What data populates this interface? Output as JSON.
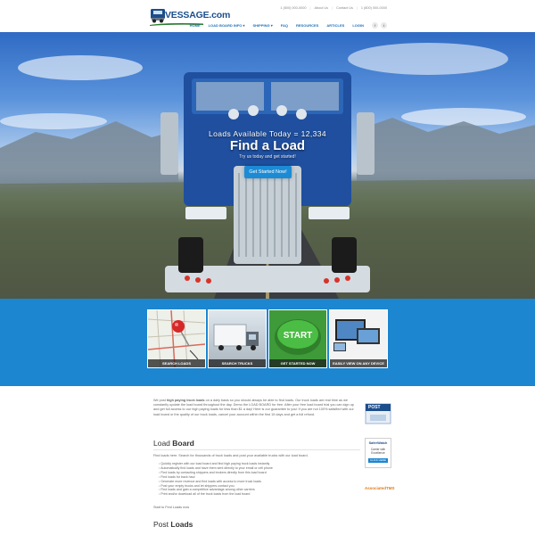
{
  "brand": {
    "name": "VESSAGE.com"
  },
  "utility": {
    "items": [
      "1 (800) 000-0000",
      "About Us",
      "Contact Us",
      "1 (800) 000-0000"
    ]
  },
  "nav": {
    "items": [
      "Home",
      "Load Board Info ▾",
      "Shipping ▾",
      "FAQ",
      "Resources",
      "Articles",
      "Login"
    ],
    "social": [
      "f",
      "t"
    ]
  },
  "hero": {
    "count_label": "Loads Available Today = 12,334",
    "title": "Find a Load",
    "subtitle": "Try us today and get started!",
    "cta": "Get Started Now!"
  },
  "tiles": [
    {
      "caption": "Search Loads",
      "icon": "map-pin-icon"
    },
    {
      "caption": "Search Trucks",
      "icon": "truck-icon"
    },
    {
      "caption": "Get Started Now",
      "icon": "start-button-icon"
    },
    {
      "caption": "Easily View on Any Device",
      "icon": "devices-icon"
    }
  ],
  "intro": {
    "lead": "We post ",
    "bold1": "high paying truck loads",
    "rest": " on a daily basis so you should always be able to find loads. Our truck loads are real time as we constantly update the load board throughout the day. Demo the LOAD BOARD for free. After your free load board trial you can sign up and get full access to our high paying loads for less than $1 a day! Here is our guarantee to you! If you are not 100% satisfied with our load board or the quality of our truck loads, cancel your account within the first 15 days and get a full refund."
  },
  "load_board": {
    "title_light": "Load ",
    "title_bold": "Board",
    "intro_link": "Find loads",
    "intro_rest": " here. Search for thousands of truck loads and post your available trucks with our load board.",
    "bullets": [
      "Quickly register with our load board and find high paying truck loads instantly",
      "Automatically find loads and have them sent directly to your email or cell phone",
      "Find loads by contacting shippers and brokers directly from this load board",
      "Find loads for back haul",
      "Generate more revenue and find loads with access to more truck loads",
      "Post your empty trucks and let shippers contact you",
      "Find loads and gain a competitive advantage among other carriers",
      "Print and/or download all of the truck loads from the load board"
    ],
    "start_text": "Start to ",
    "start_link": "Find Loads",
    "start_tail": " now"
  },
  "post_loads": {
    "title_light": "Post ",
    "title_bold": "Loads"
  },
  "sidebar": {
    "post_badge": "POST",
    "safer_title": "SaferWatch",
    "safer_lines": [
      "Carrier with",
      "Excellence"
    ],
    "safer_cta": "CLICK HERE",
    "dat_logo": "AssociatedTMS"
  },
  "colors": {
    "accent": "#1c86d1",
    "nav": "#1d6fb8",
    "cta": "#1c8bd6"
  }
}
